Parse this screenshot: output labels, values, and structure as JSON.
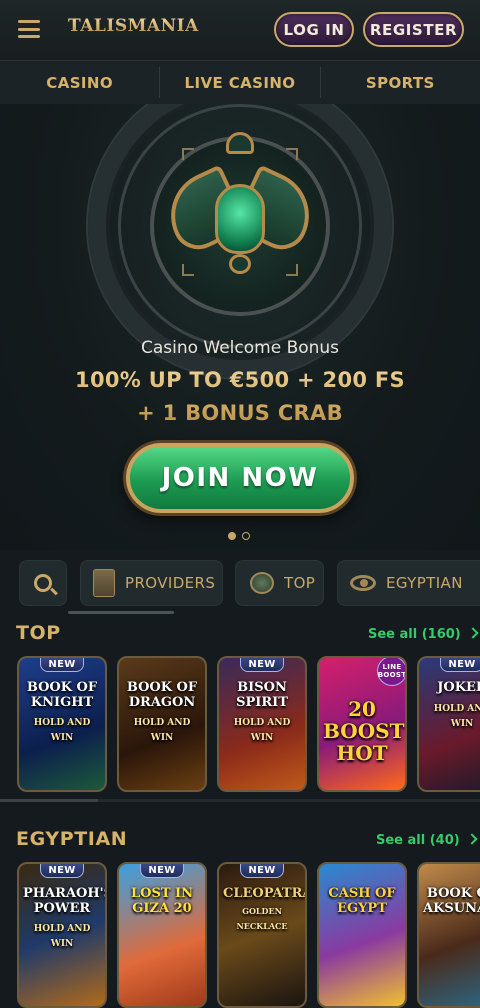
{
  "header": {
    "logo": "TALISMANIA",
    "login_label": "LOG IN",
    "register_label": "REGISTER"
  },
  "nav": {
    "tabs": [
      "CASINO",
      "LIVE CASINO",
      "SPORTS"
    ]
  },
  "hero": {
    "subtitle": "Casino Welcome Bonus",
    "title_line1": "100% UP TO €500 + 200 FS",
    "title_line2": "+ 1 BONUS CRAB",
    "cta": "JOIN NOW",
    "slides": 2,
    "active_slide": 1
  },
  "filters": {
    "providers": "PROVIDERS",
    "top": "TOP",
    "egyptian": "EGYPTIAN"
  },
  "sections": {
    "top": {
      "title": "TOP",
      "see_all": "See all (160)",
      "games": [
        {
          "name": "BOOK OF KNIGHT",
          "sub": "HOLD AND WIN",
          "badge": "NEW"
        },
        {
          "name": "BOOK OF DRAGON",
          "sub": "HOLD AND WIN",
          "badge": ""
        },
        {
          "name": "BISON SPIRIT",
          "sub": "HOLD AND WIN",
          "badge": "NEW"
        },
        {
          "name": "20 BOOST HOT",
          "sub": "",
          "badge": "LINE BOOST"
        },
        {
          "name": "JOKER",
          "sub": "HOLD AND WIN",
          "badge": "NEW"
        }
      ]
    },
    "egyptian": {
      "title": "EGYPTIAN",
      "see_all": "See all (40)",
      "games": [
        {
          "name": "PHARAOH'S POWER",
          "sub": "HOLD AND WIN",
          "badge": "NEW"
        },
        {
          "name": "LOST IN GIZA 20",
          "sub": "",
          "badge": "NEW"
        },
        {
          "name": "CLEOPATRA",
          "sub": "GOLDEN NECKLACE",
          "badge": "NEW"
        },
        {
          "name": "CASH OF EGYPT",
          "sub": "",
          "badge": ""
        },
        {
          "name": "BOOK OF AKSUNAM",
          "sub": "",
          "badge": ""
        }
      ]
    }
  }
}
